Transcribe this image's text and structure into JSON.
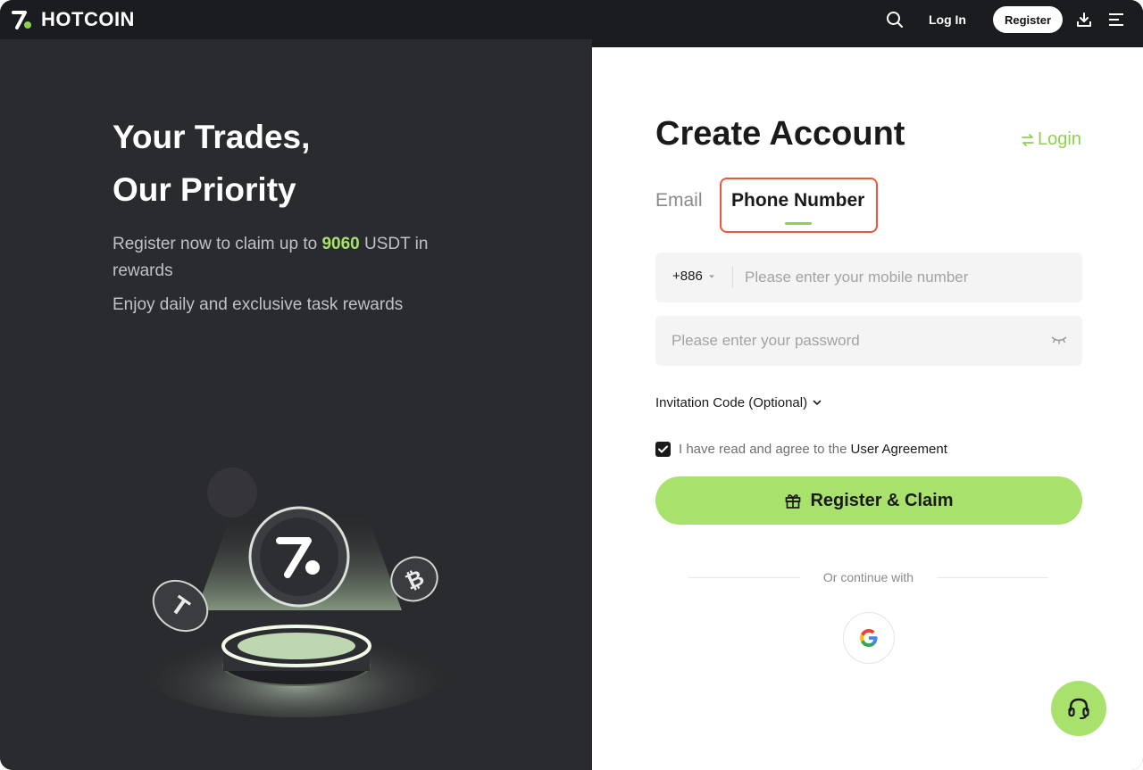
{
  "brand": {
    "name": "HOTCOIN",
    "accent": "#a8e26d"
  },
  "nav": {
    "search_icon": "search-icon",
    "login_label": "Log In",
    "register_label": "Register",
    "download_icon": "download-icon",
    "menu_icon": "hamburger-menu-icon"
  },
  "hero": {
    "title_line1": "Your Trades,",
    "title_line2": "Our Priority",
    "sub_prefix": "Register now to claim up to ",
    "sub_amount": "9060",
    "sub_suffix": " USDT in rewards",
    "sub2": "Enjoy daily and exclusive task rewards"
  },
  "form": {
    "title": "Create Account",
    "switch_login": "Login",
    "tabs": [
      {
        "label": "Email",
        "active": false
      },
      {
        "label": "Phone Number",
        "active": true
      }
    ],
    "country_code": "+886",
    "phone_placeholder": "Please enter your mobile number",
    "password_placeholder": "Please enter your password",
    "invitation_label": "Invitation Code (Optional)",
    "agree_text": "I have read and agree to the",
    "agree_link": "User Agreement",
    "agree_checked": true,
    "cta_label": "Register & Claim",
    "or_text": "Or continue with",
    "social": [
      "google-icon"
    ]
  },
  "support_icon": "headset-icon"
}
